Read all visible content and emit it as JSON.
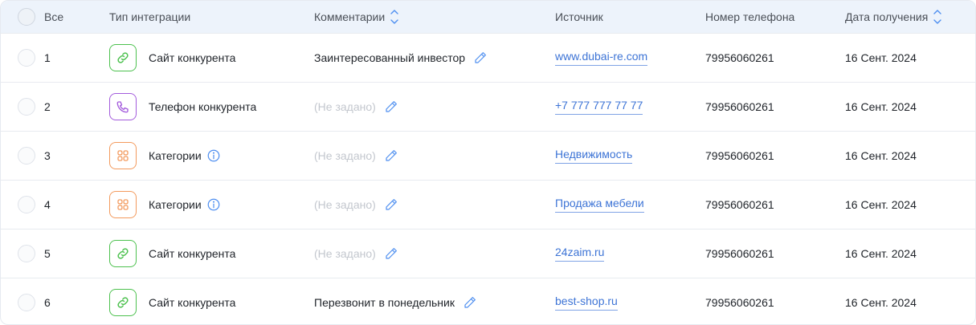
{
  "header": {
    "all_label": "Все",
    "type_label": "Тип интеграции",
    "comment_label": "Комментарии",
    "source_label": "Источник",
    "phone_label": "Номер телефона",
    "date_label": "Дата получения"
  },
  "colors": {
    "header_bg": "#edf3fb",
    "link": "#3d74d6",
    "site_icon": "#4cc14e",
    "phone_icon": "#a35bdc",
    "category_icon": "#f39a5d",
    "muted_text": "#c3c7ce"
  },
  "rows": [
    {
      "num": "1",
      "type": "Сайт конкурента",
      "icon": "link-icon",
      "comment": "Заинтересованный инвестор",
      "source": "www.dubai-re.com",
      "phone": "79956060261",
      "date": "16 Сент. 2024"
    },
    {
      "num": "2",
      "type": "Телефон конкурента",
      "icon": "phone-icon",
      "comment": "(Не задано)",
      "source": "+7 777 777 77 77",
      "phone": "79956060261",
      "date": "16 Сент. 2024"
    },
    {
      "num": "3",
      "type": "Категории",
      "icon": "grid-icon",
      "comment": "(Не задано)",
      "source": "Недвижимость",
      "phone": "79956060261",
      "date": "16 Сент. 2024"
    },
    {
      "num": "4",
      "type": "Категории",
      "icon": "grid-icon",
      "comment": "(Не задано)",
      "source": "Продажа мебели",
      "phone": "79956060261",
      "date": "16 Сент. 2024"
    },
    {
      "num": "5",
      "type": "Сайт конкурента",
      "icon": "link-icon",
      "comment": "(Не задано)",
      "source": "24zaim.ru",
      "phone": "79956060261",
      "date": "16 Сент. 2024"
    },
    {
      "num": "6",
      "type": "Сайт конкурента",
      "icon": "link-icon",
      "comment": "Перезвонит в понедельник",
      "source": "best-shop.ru",
      "phone": "79956060261",
      "date": "16 Сент. 2024"
    }
  ]
}
